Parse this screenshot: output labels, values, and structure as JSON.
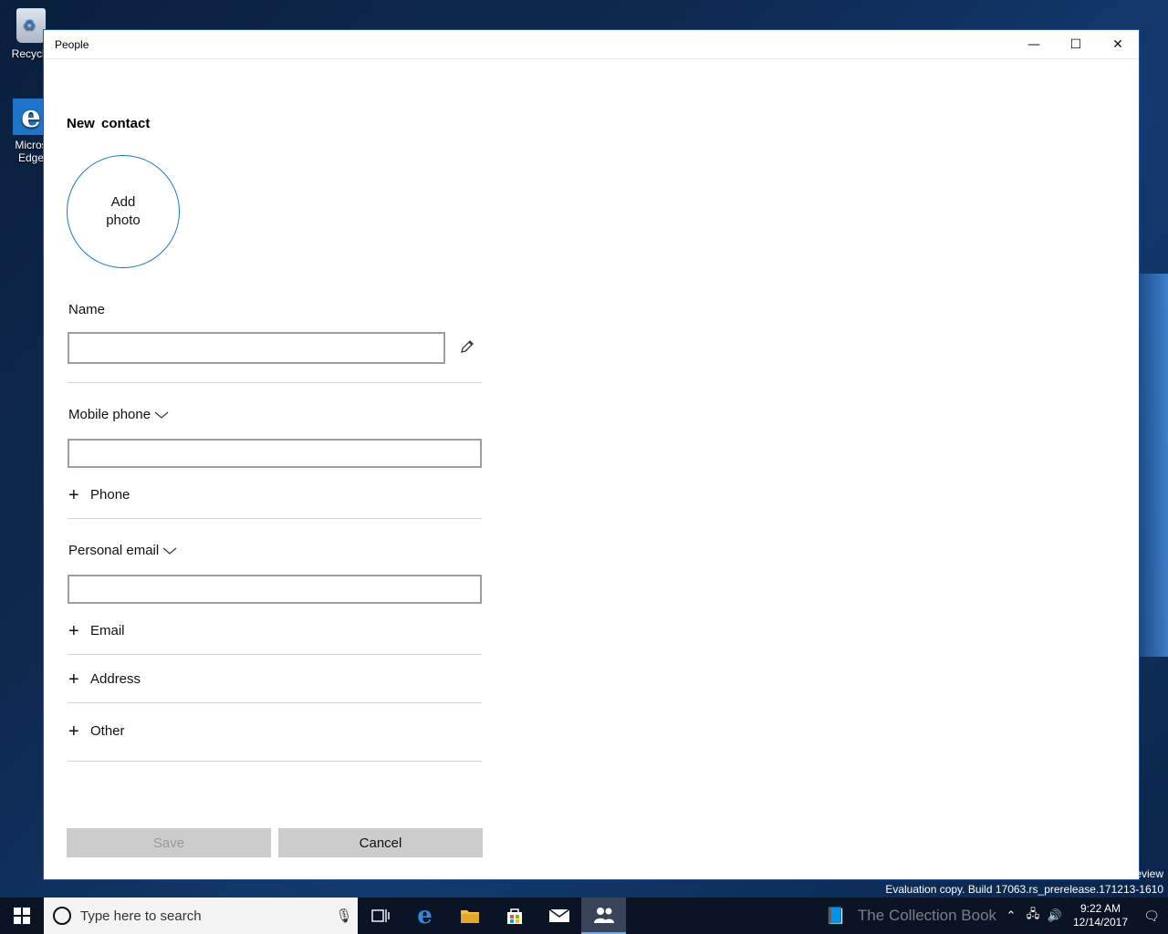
{
  "desktop": {
    "icons": [
      {
        "label": "Recycle"
      },
      {
        "label": "Micros Edge"
      }
    ],
    "watermark_line1": "eview",
    "watermark_line2": "Evaluation copy. Build 17063.rs_prerelease.171213-1610"
  },
  "window": {
    "title": "People",
    "minimize": "—",
    "maximize": "☐",
    "close": "✕"
  },
  "form": {
    "heading": "New  contact",
    "add_photo": "Add photo",
    "name_label": "Name",
    "name_value": "",
    "phone_type_label": "Mobile phone",
    "phone_value": "",
    "add_phone": "Phone",
    "email_type_label": "Personal email",
    "email_value": "",
    "add_email": "Email",
    "add_address": "Address",
    "add_other": "Other",
    "save_label": "Save",
    "cancel_label": "Cancel"
  },
  "taskbar": {
    "search_placeholder": "Type here to search",
    "time": "9:22 AM",
    "date": "12/14/2017",
    "tray_text": "The Collection Book"
  }
}
